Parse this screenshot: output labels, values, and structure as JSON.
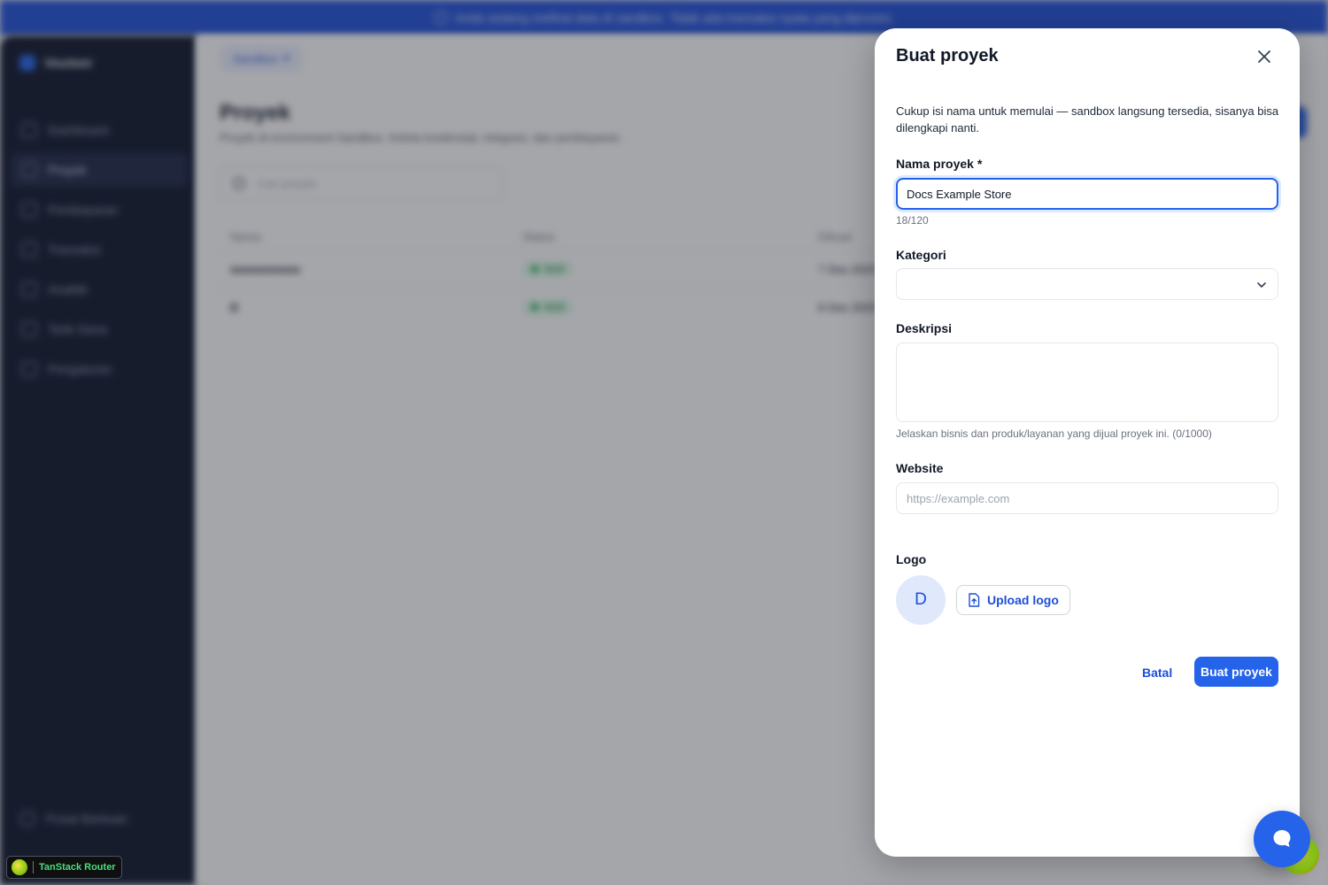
{
  "banner": {
    "text": "Anda sedang melihat data di sandbox. Tidak ada transaksi nyata yang diproses."
  },
  "sidebar": {
    "brand": "Vouteer",
    "items": [
      {
        "label": "Dashboard",
        "active": false
      },
      {
        "label": "Proyek",
        "active": true
      },
      {
        "label": "Pembayaran",
        "active": false
      },
      {
        "label": "Transaksi",
        "active": false
      },
      {
        "label": "Analitik",
        "active": false
      },
      {
        "label": "Tarik Dana",
        "active": false
      },
      {
        "label": "Pengaturan",
        "active": false
      }
    ],
    "bottom_item": "Pusat Bantuan"
  },
  "main": {
    "env_chip": "Sandbox",
    "title": "Proyek",
    "subtitle": "Proyek di environment Sandbox. Kelola kredensial, integrasi, dan pembayaran.",
    "search_placeholder": "Cari proyek",
    "table": {
      "headers": [
        "Nama",
        "Status",
        "Dibuat"
      ],
      "rows": [
        {
          "name": "nnnnnnnnnn",
          "status": "Aktif",
          "date": "7 Des 2025"
        },
        {
          "name": "D",
          "status": "Aktif",
          "date": "8 Des 2025"
        }
      ]
    }
  },
  "devtools": {
    "label": "TanStack Router"
  },
  "modal": {
    "title": "Buat proyek",
    "description": "Cukup isi nama untuk memulai — sandbox langsung tersedia, sisanya bisa dilengkapi nanti.",
    "name_label": "Nama proyek *",
    "name_value": "Docs Example Store",
    "name_counter": "18/120",
    "category_label": "Kategori",
    "category_value": "",
    "description_label": "Deskripsi",
    "description_hint": "Jelaskan bisnis dan produk/layanan yang dijual proyek ini. (0/1000)",
    "website_label": "Website",
    "website_placeholder": "https://example.com",
    "logo_label": "Logo",
    "avatar_letter": "D",
    "upload_label": "Upload logo",
    "cancel_label": "Batal",
    "submit_label": "Buat proyek"
  },
  "colors": {
    "accent": "#2563eb",
    "sidebar_bg": "#0b1229",
    "banner_bg": "#1d4ed8",
    "success": "#16a34a"
  }
}
